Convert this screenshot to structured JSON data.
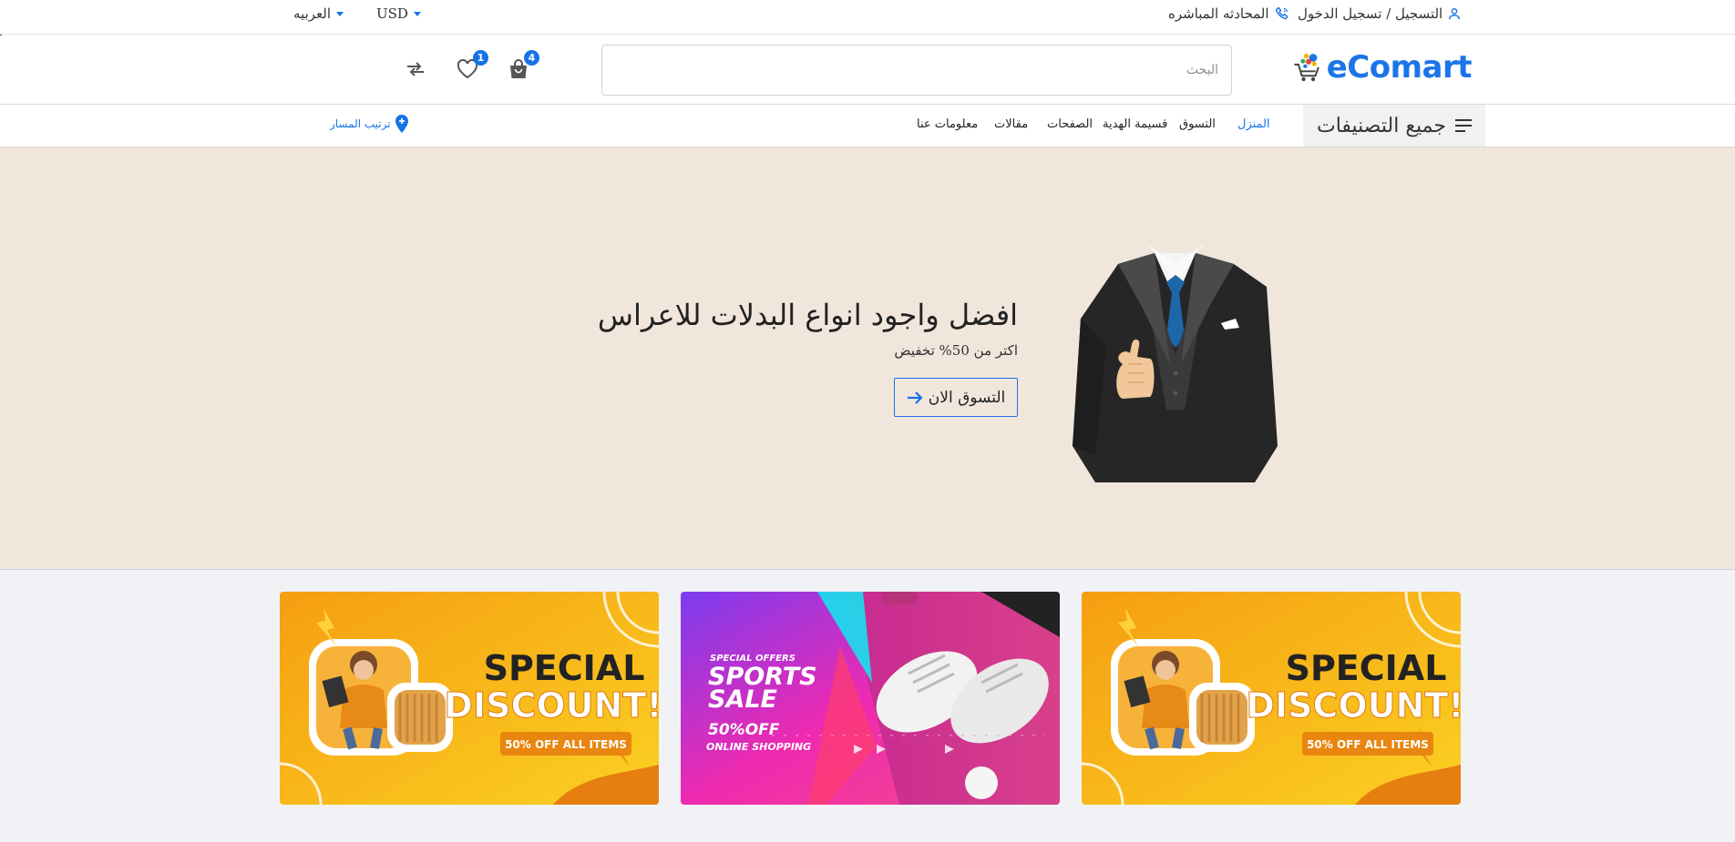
{
  "topbar": {
    "account_label": "التسجيل / تسجيل الدخول",
    "live_chat_label": "المحادثه المباشره",
    "currency": "USD",
    "language": "العربيه"
  },
  "header": {
    "logo_text": "eComart",
    "search_placeholder": "البحث",
    "cart_count": "4",
    "wishlist_count": "1"
  },
  "nav": {
    "all_categories": "جميع التصنيفات",
    "links": [
      "المنزل",
      "التسوق",
      "قسيمة الهدية",
      "الصفحات",
      "مقالات",
      "معلومات عنا"
    ],
    "route_label": "ترتيب المسار"
  },
  "hero": {
    "title": "افضل واجود انواع البدلات للاعراس",
    "subtitle": "اكتر من 50% تخفيض",
    "button_label": "التسوق الان"
  },
  "banners": [
    {
      "heading1": "SPECIAL",
      "heading2": "DISCOUNT!",
      "tag": "50% OFF ALL ITEMS"
    },
    {
      "eyebrow": "SPECIAL OFFERS",
      "heading1": "SPORTS",
      "heading2": "SALE",
      "line1": "50%OFF",
      "line2": "ONLINE SHOPPING"
    },
    {
      "heading1": "SPECIAL",
      "heading2": "DISCOUNT!",
      "tag": "50% OFF ALL ITEMS"
    }
  ],
  "colors": {
    "accent": "#1673e6",
    "hero_bg": "#f1e6dc",
    "banner_orange": "#f7a21b",
    "banner_pink": "#e92ba8"
  }
}
